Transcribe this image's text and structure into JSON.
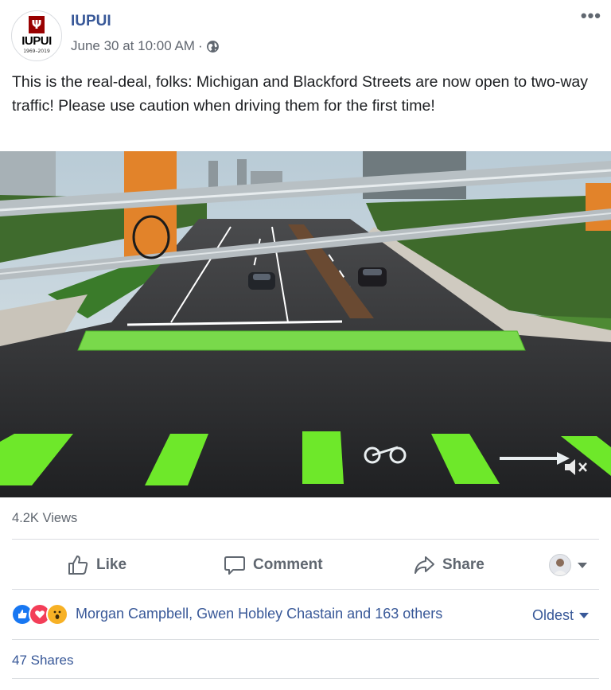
{
  "post": {
    "page_name": "IUPUI",
    "avatar": {
      "logo_text": "IUPUI",
      "years": "1969–2019",
      "brand_color": "#990000"
    },
    "timestamp": "June 30 at 10:00 AM",
    "separator": "·",
    "privacy_icon": "globe-icon",
    "more_icon": "more-options-icon",
    "message": "This is the real-deal, folks: Michigan and Blackford Streets are now open to two-way traffic! Please use caution when driving them for the first time!"
  },
  "video": {
    "mute_icon": "muted-speaker-icon",
    "muted": true
  },
  "stats": {
    "views": "4.2K Views"
  },
  "actions": {
    "like": "Like",
    "comment": "Comment",
    "share": "Share"
  },
  "reactions": {
    "types": [
      "like",
      "love",
      "wow"
    ],
    "text": "Morgan Campbell, Gwen Hobley Chastain and 163 others",
    "sort_label": "Oldest"
  },
  "shares": "47 Shares",
  "colors": {
    "link": "#385898",
    "muted_text": "#606770",
    "like_blue": "#1877f2",
    "love_red": "#f33e58",
    "wow_yellow": "#f7b125",
    "bike_lane_green": "#6ee82a"
  }
}
